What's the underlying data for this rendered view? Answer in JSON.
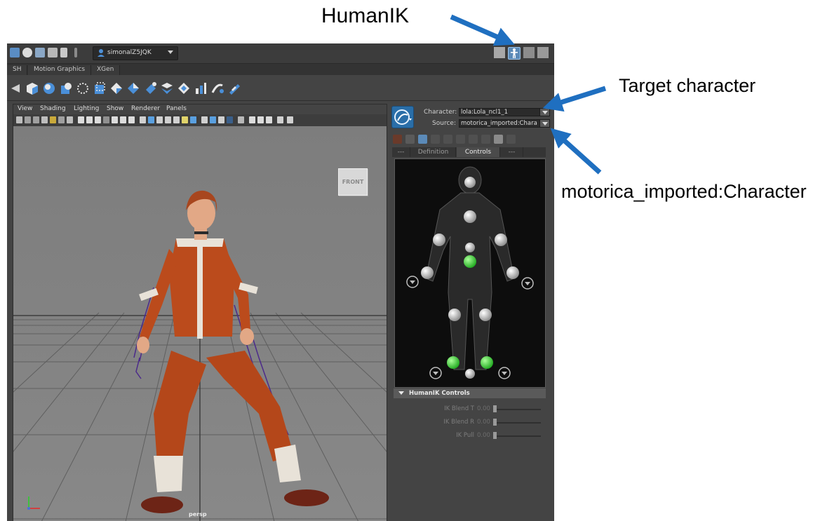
{
  "toolbar": {
    "workspace_user": "simonalZ5JQK"
  },
  "shelf": {
    "tabs": [
      "SH",
      "Motion Graphics",
      "XGen"
    ]
  },
  "viewport": {
    "menu": [
      "View",
      "Shading",
      "Lighting",
      "Show",
      "Renderer",
      "Panels"
    ],
    "view_cube_label": "FRONT",
    "camera_label": "persp"
  },
  "humanik": {
    "character_label": "Character:",
    "character_value": "lola:Lola_ncl1_1",
    "source_label": "Source:",
    "source_value": "motorica_imported:Chara",
    "tabs": [
      "---",
      "Definition",
      "Controls",
      "---"
    ],
    "active_tab": "Controls",
    "controls_header": "HumanIK Controls",
    "sliders": [
      {
        "label": "IK Blend T",
        "value": "0.00"
      },
      {
        "label": "IK Blend R",
        "value": "0.00"
      },
      {
        "label": "IK Pull",
        "value": "0.00"
      }
    ]
  },
  "annotations": {
    "humanik": "HumanIK",
    "target_character": "Target character",
    "source_character": "motorica_imported:Character"
  },
  "colors": {
    "arrow": "#1f6fc0",
    "effector_active": "#33cc33",
    "effector_idle": "#bdbdbd",
    "ui_dark": "#444444"
  }
}
